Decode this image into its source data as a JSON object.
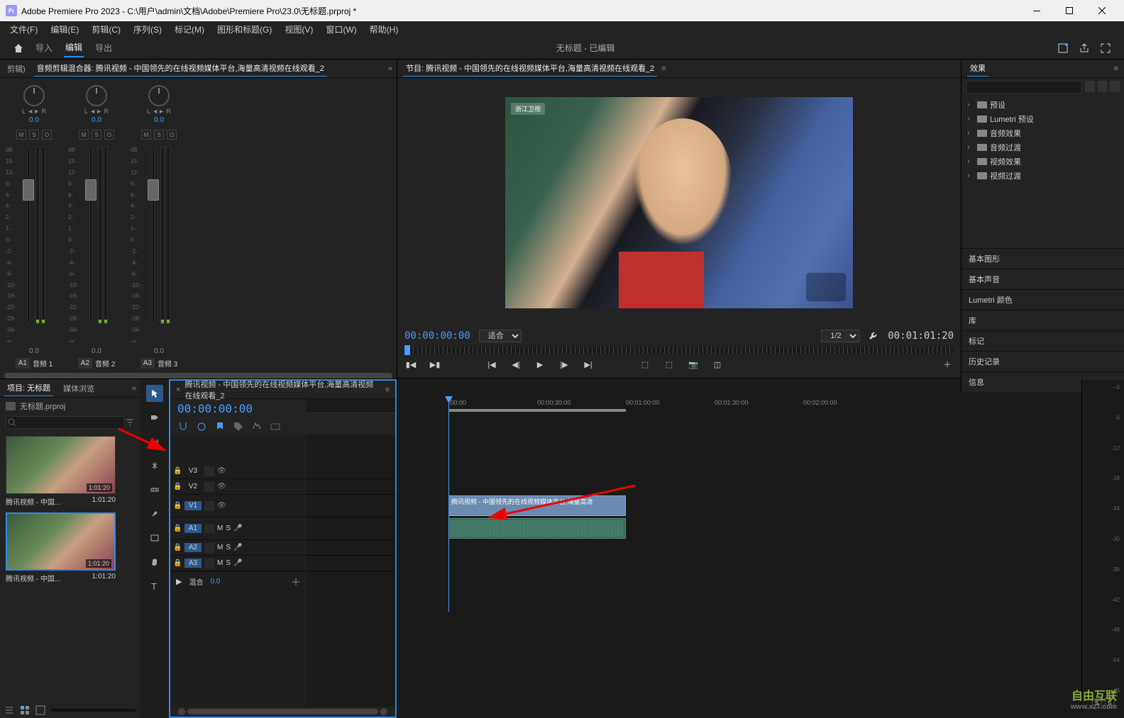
{
  "titlebar": {
    "app_badge": "Pr",
    "title": "Adobe Premiere Pro 2023 - C:\\用户\\admin\\文档\\Adobe\\Premiere Pro\\23.0\\无标题.prproj *"
  },
  "menubar": [
    "文件(F)",
    "编辑(E)",
    "剪辑(C)",
    "序列(S)",
    "标记(M)",
    "图形和标题(G)",
    "视图(V)",
    "窗口(W)",
    "帮助(H)"
  ],
  "workspace": {
    "tabs": [
      "导入",
      "编辑",
      "导出"
    ],
    "active": 1,
    "center": "无标题 - 已编辑"
  },
  "mixer": {
    "tab_left": "剪辑)",
    "tab_active": "音频剪辑混合器: 腾讯视频 - 中国领先的在线视频媒体平台,海量高清视频在线观看_2",
    "channels": [
      {
        "pan_label": "L ◄► R",
        "pan_val": "0.0",
        "val": "0.0",
        "id": "A1",
        "name": "音频 1"
      },
      {
        "pan_label": "L ◄► R",
        "pan_val": "0.0",
        "val": "0.0",
        "id": "A2",
        "name": "音频 2"
      },
      {
        "pan_label": "L ◄► R",
        "pan_val": "0.0",
        "val": "0.0",
        "id": "A3",
        "name": "音频 3"
      }
    ],
    "db_scale": [
      "dB",
      "15-",
      "12-",
      "9-",
      "6-",
      "4-",
      "2-",
      "1-",
      "0-",
      "-2-",
      "-4-",
      "-6-",
      "-10-",
      "-16-",
      "-22-",
      "-28-",
      "-34-",
      "-∞"
    ]
  },
  "project": {
    "tab1": "项目: 无标题",
    "tab2": "媒体浏览",
    "filename": "无标题.prproj",
    "items": [
      {
        "name": "腾讯视频 - 中国...",
        "dur": "1:01:20"
      },
      {
        "name": "腾讯视频 - 中国...",
        "dur": "1:01:20"
      }
    ]
  },
  "program": {
    "tab": "节目: 腾讯视频 - 中国领先的在线视频媒体平台,海量高清视频在线观看_2",
    "logo": "浙江卫视",
    "tc_left": "00:00:00:00",
    "fit": "适合",
    "res": "1/2",
    "tc_right": "00:01:01:20"
  },
  "effects": {
    "title": "效果",
    "tree": [
      "预设",
      "Lumetri 预设",
      "音频效果",
      "音频过渡",
      "视频效果",
      "视频过渡"
    ]
  },
  "side_panels": [
    "基本图形",
    "基本声音",
    "Lumetri 颜色",
    "库",
    "标记",
    "历史记录",
    "信息"
  ],
  "timeline": {
    "tab": "腾讯视频 - 中国领先的在线视频媒体平台,海量高清视频在线观看_2",
    "tc": "00:00:00:00",
    "ruler": [
      ":00:00",
      "00:00:30:00",
      "00:01:00:00",
      "00:01:30:00",
      "00:02:00:00"
    ],
    "video_tracks": [
      "V3",
      "V2",
      "V1"
    ],
    "audio_tracks": [
      "A1",
      "A2",
      "A3"
    ],
    "clip_label": "腾讯视频 - 中国领先的在线视频媒体平台,海量高清",
    "mix_label": "混合",
    "mix_val": "0.0"
  },
  "meter_right": {
    "scale": [
      "--0",
      "-6",
      "-12",
      "-18",
      "-24",
      "-30",
      "-36",
      "-42",
      "-48",
      "-54",
      "dB"
    ]
  },
  "watermark": {
    "brand": "自由互联",
    "url": "www.xz7.com"
  }
}
